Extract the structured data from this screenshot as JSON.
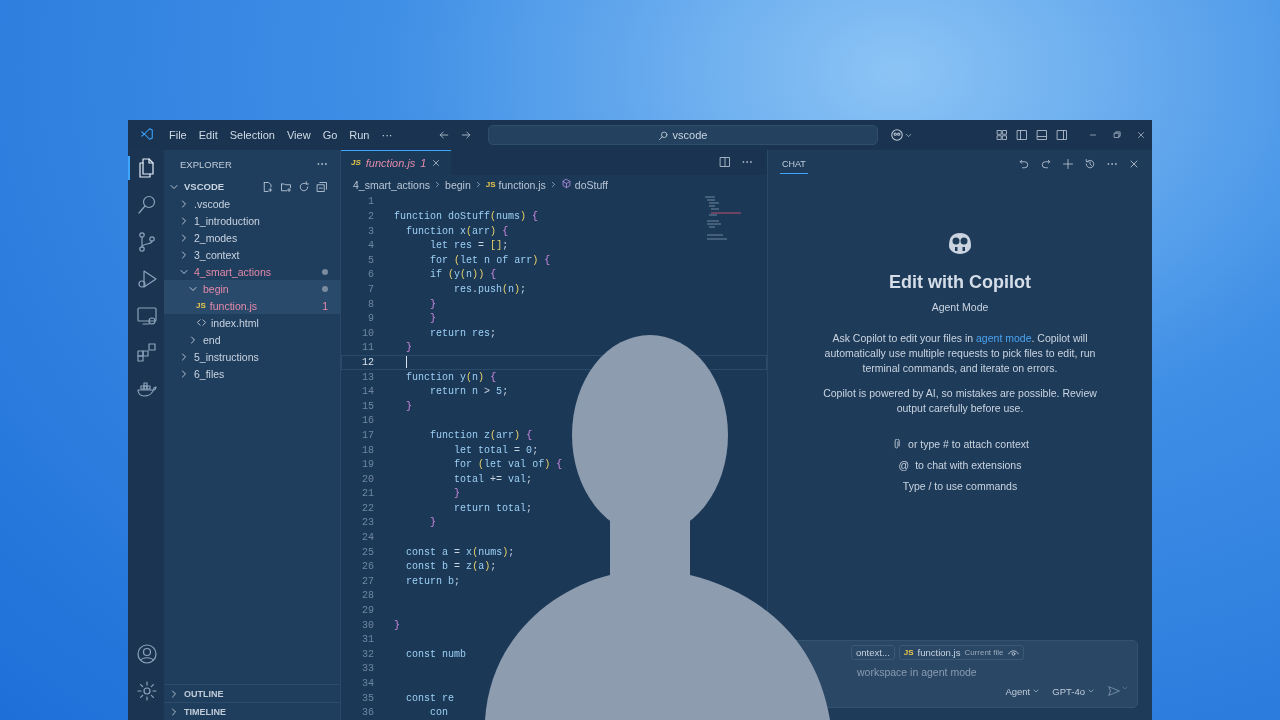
{
  "title_bar": {
    "menus": [
      "File",
      "Edit",
      "Selection",
      "View",
      "Go",
      "Run",
      "···"
    ],
    "search": "vscode"
  },
  "activity_bar": {
    "items": [
      {
        "kind": "files",
        "selected": true
      },
      {
        "kind": "search",
        "selected": false
      },
      {
        "kind": "branch",
        "selected": false
      },
      {
        "kind": "debug",
        "selected": false
      },
      {
        "kind": "remote",
        "selected": false
      },
      {
        "kind": "extensions",
        "selected": false
      },
      {
        "kind": "docker",
        "selected": false
      }
    ],
    "bottom": [
      {
        "kind": "account"
      },
      {
        "kind": "settings"
      }
    ]
  },
  "sidebar": {
    "title": "EXPLORER",
    "root": {
      "label": "VSCODE",
      "expanded": true
    },
    "tree": [
      {
        "label": ".vscode",
        "kind": "folder",
        "expanded": false,
        "selected": false,
        "error": false
      },
      {
        "label": "1_introduction",
        "kind": "folder",
        "expanded": false,
        "selected": false,
        "error": false
      },
      {
        "label": "2_modes",
        "kind": "folder",
        "expanded": false,
        "selected": false,
        "error": false
      },
      {
        "label": "3_context",
        "kind": "folder",
        "expanded": false,
        "selected": false,
        "error": false
      },
      {
        "label": "4_smart_actions",
        "kind": "folder",
        "expanded": true,
        "selected": false,
        "error": true,
        "children": [
          {
            "label": "begin",
            "kind": "folder",
            "expanded": true,
            "selected": true,
            "error": true,
            "children": [
              {
                "label": "function.js",
                "kind": "js",
                "icon_text": "JS",
                "badge": "1",
                "selected": true,
                "error": true
              },
              {
                "label": "index.html",
                "kind": "html",
                "selected": false,
                "error": false
              }
            ]
          },
          {
            "label": "end",
            "kind": "folder",
            "expanded": false,
            "selected": false,
            "error": false
          }
        ]
      },
      {
        "label": "5_instructions",
        "kind": "folder",
        "expanded": false,
        "selected": false,
        "error": false
      },
      {
        "label": "6_files",
        "kind": "folder",
        "expanded": false,
        "selected": false,
        "error": false
      }
    ],
    "sections": [
      {
        "label": "OUTLINE",
        "expanded": false
      },
      {
        "label": "TIMELINE",
        "expanded": false
      }
    ]
  },
  "editor": {
    "tabs": [
      {
        "label": "function.js",
        "icon_text": "JS",
        "badge": "1",
        "selected": true,
        "error": true
      }
    ],
    "breadcrumbs": [
      {
        "kind": "folder",
        "label": "4_smart_actions"
      },
      {
        "kind": "folder",
        "label": "begin"
      },
      {
        "kind": "js",
        "icon_text": "JS",
        "label": "function.js"
      },
      {
        "kind": "symbol",
        "label": "doStuff"
      }
    ],
    "lines": [
      {
        "number": "1",
        "active": false
      },
      {
        "number": "2",
        "text": "function doStuff(nums) {",
        "active": false
      },
      {
        "number": "3",
        "text": "  function x(arr) {",
        "active": false
      },
      {
        "number": "4",
        "text": "      let res = [];",
        "active": false
      },
      {
        "number": "5",
        "text": "      for (let n of arr) {",
        "active": false
      },
      {
        "number": "6",
        "text": "      if (y(n)) {",
        "active": false
      },
      {
        "number": "7",
        "text": "          res.push(n);",
        "active": false
      },
      {
        "number": "8",
        "text": "      }",
        "active": false
      },
      {
        "number": "9",
        "text": "      }",
        "active": false
      },
      {
        "number": "10",
        "text": "      return res;",
        "active": false
      },
      {
        "number": "11",
        "text": "  }",
        "active": false
      },
      {
        "number": "12",
        "active": true
      },
      {
        "number": "13",
        "text": "  function y(n) {",
        "active": false
      },
      {
        "number": "14",
        "text": "      return n > 5;",
        "active": false
      },
      {
        "number": "15",
        "text": "  }",
        "active": false
      },
      {
        "number": "16",
        "active": false
      },
      {
        "number": "17",
        "text": "      function z(arr) {",
        "active": false
      },
      {
        "number": "18",
        "text": "          let total = 0;",
        "active": false
      },
      {
        "number": "19",
        "text": "          for (let val of) {",
        "active": false
      },
      {
        "number": "20",
        "text": "          total += val;",
        "active": false
      },
      {
        "number": "21",
        "text": "          }",
        "active": false
      },
      {
        "number": "22",
        "text": "          return total;",
        "active": false
      },
      {
        "number": "23",
        "text": "      }",
        "active": false
      },
      {
        "number": "24",
        "active": false
      },
      {
        "number": "25",
        "text": "  const a = x(nums);",
        "active": false
      },
      {
        "number": "26",
        "text": "  const b = z(a);",
        "active": false
      },
      {
        "number": "27",
        "text": "  return b;",
        "active": false
      },
      {
        "number": "28",
        "active": false
      },
      {
        "number": "29",
        "active": false
      },
      {
        "number": "30",
        "text": "}",
        "active": false
      },
      {
        "number": "31",
        "active": false
      },
      {
        "number": "32",
        "text": "  const numb",
        "active": false
      },
      {
        "number": "33",
        "active": false
      },
      {
        "number": "34",
        "active": false
      },
      {
        "number": "35",
        "text": "  const re",
        "active": false
      },
      {
        "number": "36",
        "text": "      con",
        "active": false
      }
    ]
  },
  "chat": {
    "tab": {
      "label": "CHAT",
      "selected": true
    },
    "title": "Edit with Copilot",
    "subtitle": "Agent Mode",
    "intro": {
      "before": "Ask Copilot to edit your files in ",
      "link": "agent mode",
      "after": ". Copilot will automatically use multiple requests to pick files to edit, run terminal commands, and iterate on errors."
    },
    "note": "Copilot is powered by AI, so mistakes are possible. Review output carefully before use.",
    "hints": [
      {
        "kind": "attach",
        "text": "or type # to attach context"
      },
      {
        "kind": "mention",
        "symbol": "@",
        "text": "to chat with extensions"
      },
      {
        "kind": "command",
        "text": "Type / to use commands"
      }
    ],
    "input": {
      "chips": [
        {
          "kind": "context",
          "label": "ontext..."
        },
        {
          "kind": "file",
          "icon_text": "JS",
          "label": "function.js",
          "detail": "Current file"
        }
      ],
      "placeholder": "workspace in agent mode",
      "mode": "Agent",
      "model": "GPT-4o"
    }
  }
}
